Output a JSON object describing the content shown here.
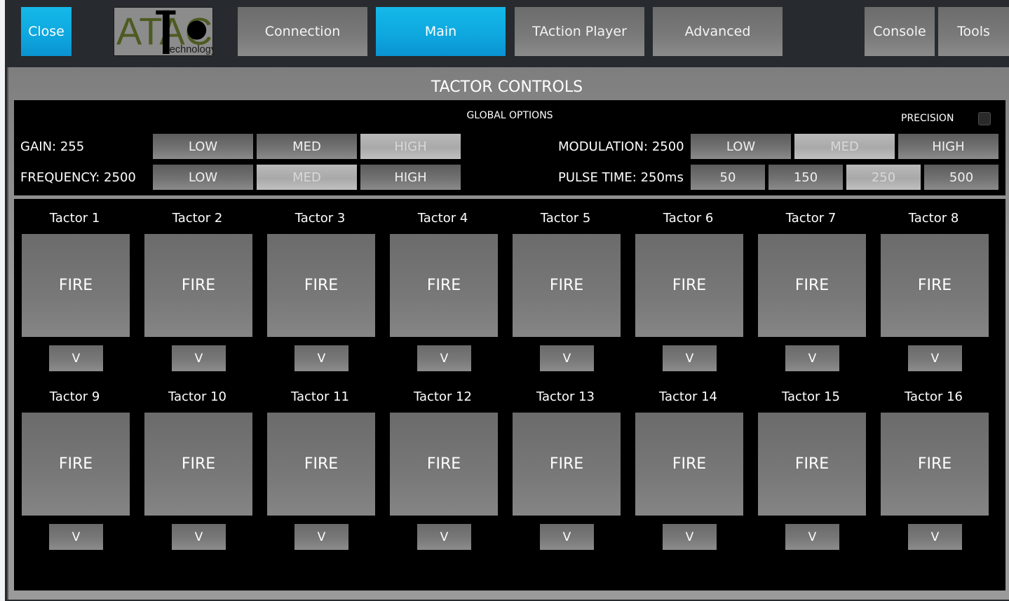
{
  "toolbar": {
    "close_label": "Close",
    "logo_text": "ATAC",
    "logo_subtext": "echnology",
    "tabs": [
      {
        "label": "Connection",
        "active": false
      },
      {
        "label": "Main",
        "active": true
      },
      {
        "label": "TAction Player",
        "active": false
      },
      {
        "label": "Advanced",
        "active": false
      }
    ],
    "console_label": "Console",
    "tools_label": "Tools"
  },
  "panel": {
    "title": "TACTOR CONTROLS"
  },
  "global_options": {
    "heading": "GLOBAL OPTIONS",
    "precision_label": "PRECISION",
    "precision_checked": false,
    "gain": {
      "label": "GAIN: 255",
      "options": [
        "LOW",
        "MED",
        "HIGH"
      ],
      "selected": "HIGH"
    },
    "frequency": {
      "label": "FREQUENCY: 2500",
      "options": [
        "LOW",
        "MED",
        "HIGH"
      ],
      "selected": "MED"
    },
    "modulation": {
      "label": "MODULATION: 2500",
      "options": [
        "LOW",
        "MED",
        "HIGH"
      ],
      "selected": "MED"
    },
    "pulse_time": {
      "label": "PULSE TIME: 250ms",
      "options": [
        "50",
        "150",
        "250",
        "500"
      ],
      "selected": "250"
    }
  },
  "tactors": [
    {
      "name": "Tactor 1",
      "fire_label": "FIRE",
      "menu_label": "V"
    },
    {
      "name": "Tactor 2",
      "fire_label": "FIRE",
      "menu_label": "V"
    },
    {
      "name": "Tactor 3",
      "fire_label": "FIRE",
      "menu_label": "V"
    },
    {
      "name": "Tactor 4",
      "fire_label": "FIRE",
      "menu_label": "V"
    },
    {
      "name": "Tactor 5",
      "fire_label": "FIRE",
      "menu_label": "V"
    },
    {
      "name": "Tactor 6",
      "fire_label": "FIRE",
      "menu_label": "V"
    },
    {
      "name": "Tactor 7",
      "fire_label": "FIRE",
      "menu_label": "V"
    },
    {
      "name": "Tactor 8",
      "fire_label": "FIRE",
      "menu_label": "V"
    },
    {
      "name": "Tactor 9",
      "fire_label": "FIRE",
      "menu_label": "V"
    },
    {
      "name": "Tactor 10",
      "fire_label": "FIRE",
      "menu_label": "V"
    },
    {
      "name": "Tactor 11",
      "fire_label": "FIRE",
      "menu_label": "V"
    },
    {
      "name": "Tactor 12",
      "fire_label": "FIRE",
      "menu_label": "V"
    },
    {
      "name": "Tactor 13",
      "fire_label": "FIRE",
      "menu_label": "V"
    },
    {
      "name": "Tactor 14",
      "fire_label": "FIRE",
      "menu_label": "V"
    },
    {
      "name": "Tactor 15",
      "fire_label": "FIRE",
      "menu_label": "V"
    },
    {
      "name": "Tactor 16",
      "fire_label": "FIRE",
      "menu_label": "V"
    }
  ],
  "colors": {
    "accent_blue": "#0ea6de",
    "toolbar_bg": "#272b2f",
    "panel_bg": "#000000"
  }
}
